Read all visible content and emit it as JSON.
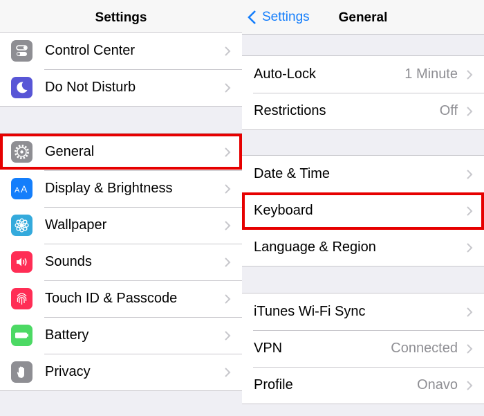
{
  "left": {
    "title": "Settings",
    "group1": [
      {
        "label": "Control Center",
        "icon": "control-center-icon",
        "color": "#8e8e93"
      },
      {
        "label": "Do Not Disturb",
        "icon": "moon-icon",
        "color": "#5856d6"
      }
    ],
    "group2": [
      {
        "label": "General",
        "icon": "gear-icon",
        "color": "#8e8e93"
      },
      {
        "label": "Display & Brightness",
        "icon": "text-size-icon",
        "color": "#147efb"
      },
      {
        "label": "Wallpaper",
        "icon": "flower-icon",
        "color": "#34aadc"
      },
      {
        "label": "Sounds",
        "icon": "speaker-icon",
        "color": "#ff2d55"
      },
      {
        "label": "Touch ID & Passcode",
        "icon": "fingerprint-icon",
        "color": "#ff2d55"
      },
      {
        "label": "Battery",
        "icon": "battery-icon",
        "color": "#4cd964"
      },
      {
        "label": "Privacy",
        "icon": "hand-icon",
        "color": "#8e8e93"
      }
    ]
  },
  "right": {
    "back_label": "Settings",
    "title": "General",
    "group1": [
      {
        "label": "Auto-Lock",
        "value": "1 Minute"
      },
      {
        "label": "Restrictions",
        "value": "Off"
      }
    ],
    "group2": [
      {
        "label": "Date & Time"
      },
      {
        "label": "Keyboard"
      },
      {
        "label": "Language & Region"
      }
    ],
    "group3": [
      {
        "label": "iTunes Wi-Fi Sync"
      },
      {
        "label": "VPN",
        "value": "Connected"
      },
      {
        "label": "Profile",
        "value": "Onavo"
      }
    ]
  },
  "highlight_color": "#e60000"
}
